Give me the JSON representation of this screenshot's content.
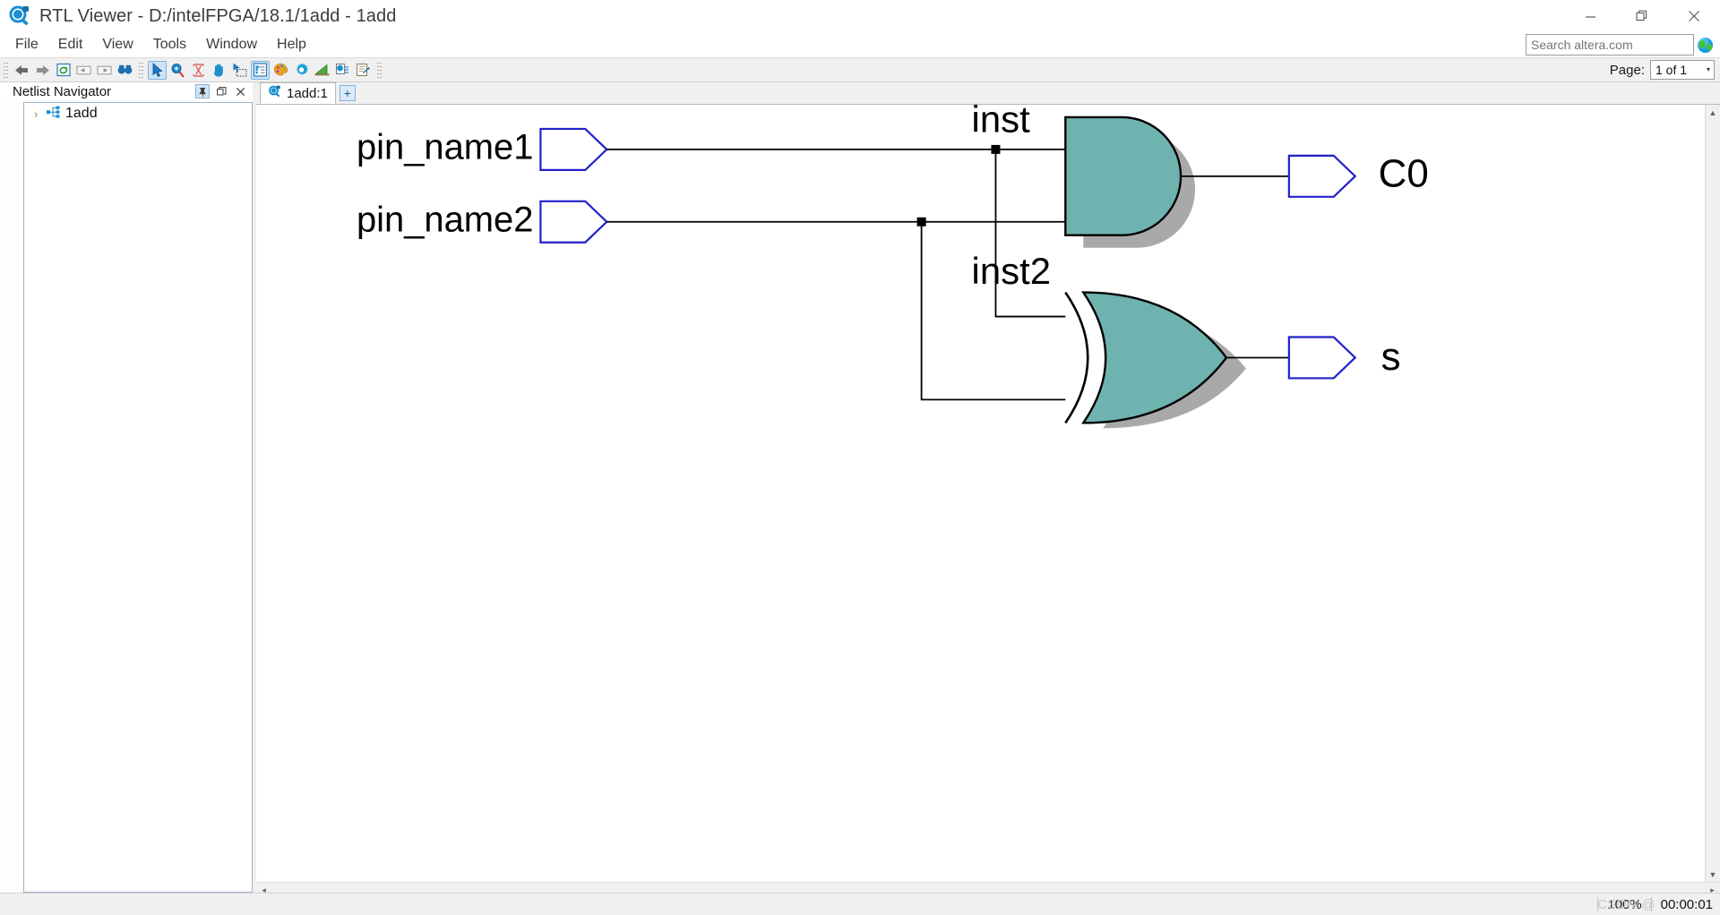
{
  "window": {
    "title": "RTL Viewer - D:/intelFPGA/18.1/1add - 1add",
    "app_icon": "rtl-viewer-icon",
    "minimize_label": "—",
    "restore_label": "❐",
    "close_label": "✕"
  },
  "menu": {
    "items": [
      {
        "label": "File"
      },
      {
        "label": "Edit"
      },
      {
        "label": "View"
      },
      {
        "label": "Tools"
      },
      {
        "label": "Window"
      },
      {
        "label": "Help"
      }
    ]
  },
  "search": {
    "placeholder": "Search altera.com",
    "value": "",
    "icon": "globe-icon"
  },
  "toolbar": {
    "group1": [
      {
        "name": "back-icon",
        "title": "Back"
      },
      {
        "name": "forward-icon",
        "title": "Forward"
      },
      {
        "name": "refresh-icon",
        "title": "Refresh"
      },
      {
        "name": "previous-page-icon",
        "title": "Previous Page"
      },
      {
        "name": "next-page-icon",
        "title": "Next Page"
      },
      {
        "name": "find-icon",
        "title": "Find"
      }
    ],
    "group2": [
      {
        "name": "select-tool-icon",
        "title": "Selection Tool",
        "active": true
      },
      {
        "name": "zoom-tool-icon",
        "title": "Zoom Tool",
        "active": false
      },
      {
        "name": "fit-in-window-icon",
        "title": "Fit in Window",
        "active": false
      },
      {
        "name": "hand-pan-icon",
        "title": "Hand Tool",
        "active": false
      },
      {
        "name": "rubber-band-select-icon",
        "title": "Area Select",
        "active": false
      },
      {
        "name": "netlist-navigator-icon",
        "title": "Netlist Navigator",
        "active": true
      },
      {
        "name": "color-palette-icon",
        "title": "Color Legend",
        "active": false
      },
      {
        "name": "settings-gear-icon",
        "title": "Settings",
        "active": false
      },
      {
        "name": "filter-icon",
        "title": "Filter",
        "active": false
      },
      {
        "name": "copy-icon",
        "title": "Copy to Clipboard",
        "active": false
      },
      {
        "name": "export-icon",
        "title": "Export",
        "active": false
      }
    ],
    "page_label": "Page:",
    "page_value": "1 of 1",
    "page_caret": "▾"
  },
  "dock": {
    "title": "Netlist Navigator",
    "pin_glyph": "⚓",
    "float_glyph": "❐",
    "close_glyph": "✕",
    "tree": [
      {
        "chevron": "›",
        "icon": "hierarchy-icon",
        "label": "1add"
      }
    ]
  },
  "tabs": {
    "items": [
      {
        "label": "1add:1",
        "icon": "rtl-viewer-icon",
        "active": true
      }
    ],
    "add_label": "+"
  },
  "schematic": {
    "inputs": [
      {
        "name": "pin_name1",
        "label": "pin_name1"
      },
      {
        "name": "pin_name2",
        "label": "pin_name2"
      }
    ],
    "gates": [
      {
        "name": "inst",
        "label": "inst",
        "type": "AND"
      },
      {
        "name": "inst2",
        "label": "inst2",
        "type": "XOR"
      }
    ],
    "outputs": [
      {
        "name": "C0",
        "label": "C0"
      },
      {
        "name": "s",
        "label": "s"
      }
    ],
    "colors": {
      "gate_fill": "#6fb3b0",
      "gate_stroke": "#000000",
      "pin_stroke": "#2020cc",
      "wire": "#000000",
      "shadow": "#8c8c8c"
    }
  },
  "status": {
    "zoom": "100%",
    "elapsed": "00:00:01",
    "watermark": "CSDN @"
  },
  "scroll": {
    "up_glyph": "▲",
    "down_glyph": "▼",
    "left_glyph": "◂",
    "right_glyph": "▸"
  }
}
